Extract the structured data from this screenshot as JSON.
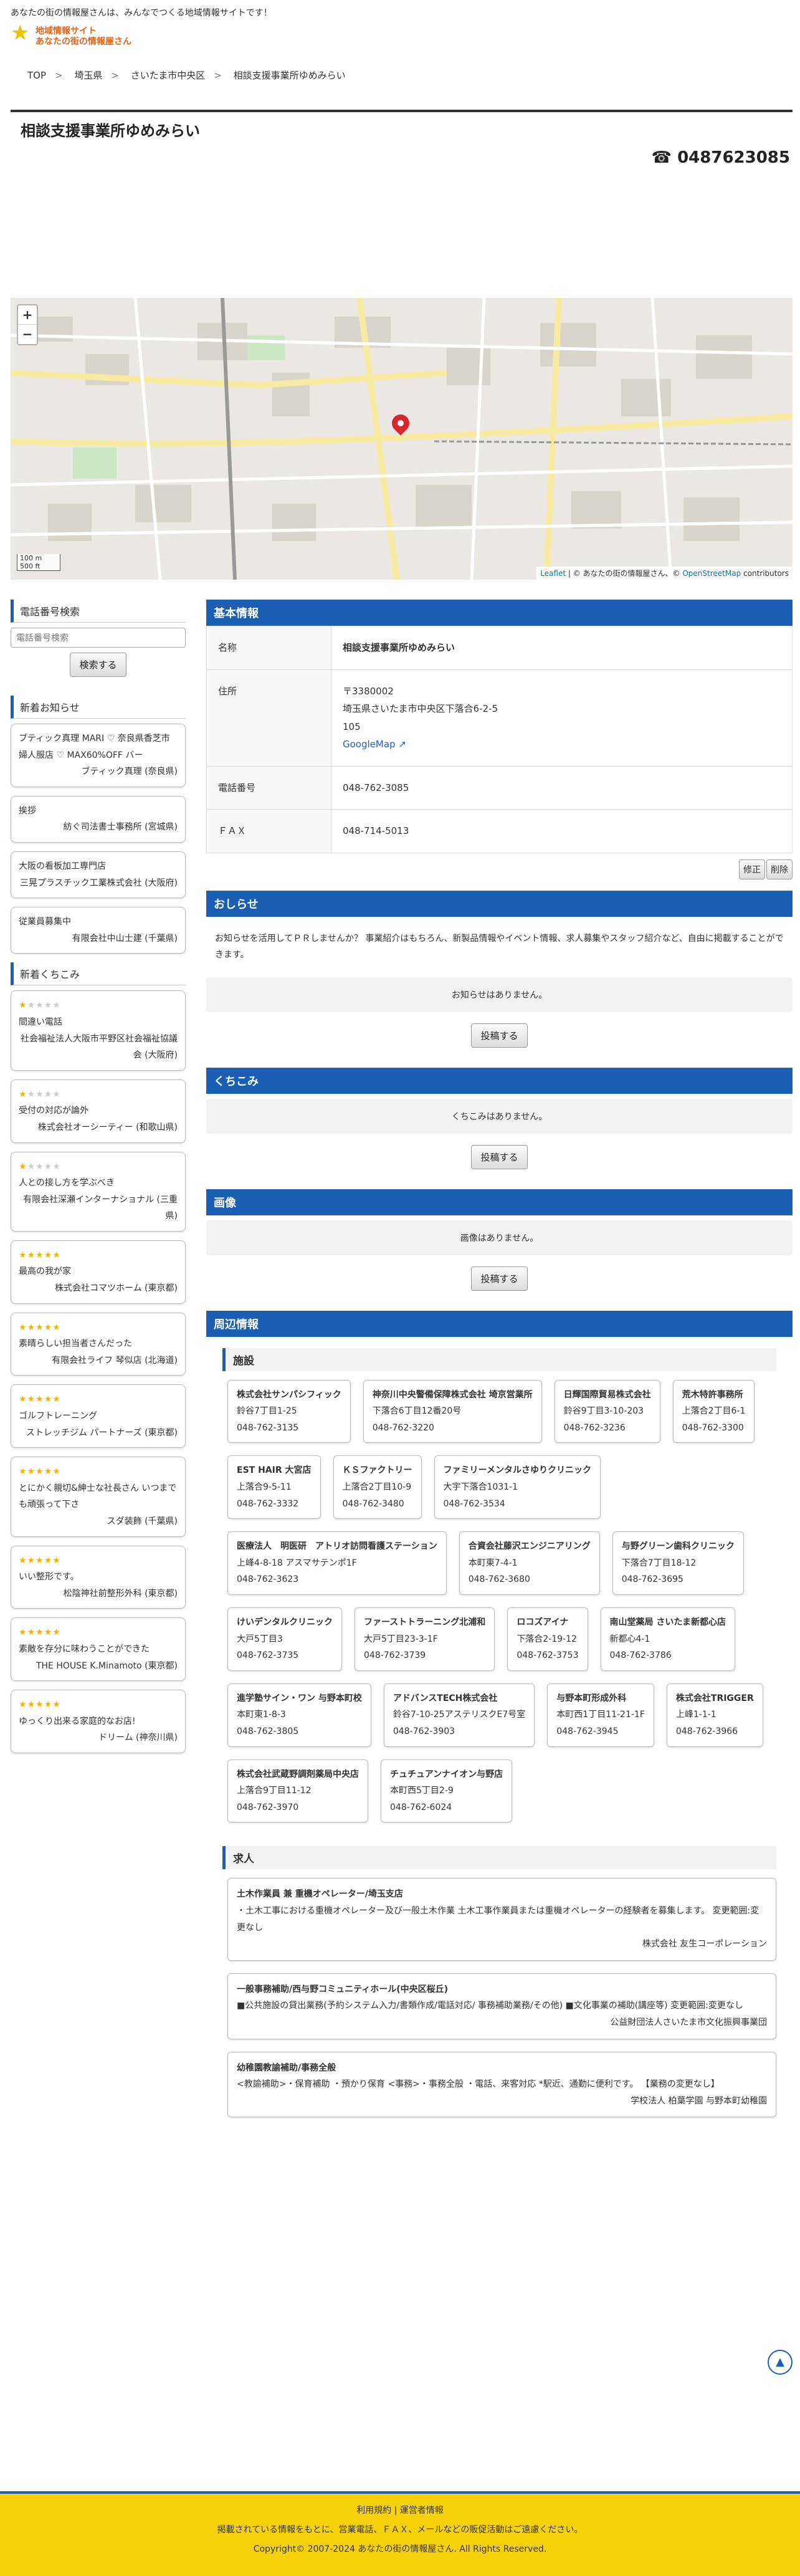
{
  "header": {
    "tagline": "あなたの街の情報屋さんは、みんなでつくる地域情報サイトです！",
    "logo_l1": "地域情報サイト",
    "logo_l2": "あなたの街の情報屋さん"
  },
  "breadcrumb": [
    "TOP",
    "埼玉県",
    "さいたま市中央区",
    "相談支援事業所ゆめみらい"
  ],
  "page": {
    "title": "相談支援事業所ゆめみらい",
    "phone": "☎ 0487623085"
  },
  "map": {
    "zoom_in": "+",
    "zoom_out": "−",
    "scale": "100 m",
    "scale2": "500 ft",
    "attrib_leaflet": "Leaflet",
    "attrib_text": " | © あなたの街の情報屋さん、© ",
    "attrib_osm": "OpenStreetMap",
    "attrib_tail": " contributors"
  },
  "sidebar": {
    "tel_search_title": "電話番号検索",
    "tel_placeholder": "電話番号検索",
    "search_button": "検索する",
    "news_title": "新着お知らせ",
    "news": [
      {
        "text": "ブティック真理 MARI ♡ 奈良県香芝市婦人服店 ♡ MAX60%OFF バー",
        "who": "ブティック真理 (奈良県)"
      },
      {
        "text": "挨拶",
        "who": "紡ぐ司法書士事務所 (宮城県)"
      },
      {
        "text": "大阪の看板加工専門店",
        "who": "三晃プラスチック工業株式会社 (大阪府)"
      },
      {
        "text": "従業員募集中",
        "who": "有限会社中山士建 (千葉県)"
      }
    ],
    "review_title": "新着くちこみ",
    "reviews": [
      {
        "stars": 1,
        "text": "間違い電話",
        "who": "社会福祉法人大阪市平野区社会福祉協議会 (大阪府)"
      },
      {
        "stars": 1,
        "text": "受付の対応が論外",
        "who": "株式会社オーシーティー (和歌山県)"
      },
      {
        "stars": 1,
        "text": "人との接し方を学ぶべき",
        "who": "有限会社深瀬インターナショナル (三重県)"
      },
      {
        "stars": 5,
        "text": "最高の我が家",
        "who": "株式会社コマツホーム (東京都)"
      },
      {
        "stars": 5,
        "text": "素晴らしい担当者さんだった",
        "who": "有限会社ライフ 琴似店 (北海道)"
      },
      {
        "stars": 5,
        "text": "ゴルフトレーニング",
        "who": "ストレッチジム パートナーズ (東京都)"
      },
      {
        "stars": 5,
        "text": "とにかく親切&紳士な社長さん いつまでも頑張って下さ",
        "who": "スダ装飾 (千葉県)"
      },
      {
        "stars": 5,
        "text": "いい整形です。",
        "who": "松陰神社前整形外科 (東京都)"
      },
      {
        "stars": 5,
        "text": "素敵を存分に味わうことができた",
        "who": "THE HOUSE K.Minamoto (東京都)"
      },
      {
        "stars": 5,
        "text": "ゆっくり出来る家庭的なお店!",
        "who": "ドリーム (神奈川県)"
      }
    ]
  },
  "basic": {
    "title": "基本情報",
    "rows": [
      {
        "k": "名称",
        "v": "相談支援事業所ゆめみらい"
      },
      {
        "k": "住所",
        "v": "〒3380002"
      },
      {
        "k": "電話番号",
        "v": "048-762-3085"
      },
      {
        "k": "ＦＡＸ",
        "v": "048-714-5013"
      }
    ],
    "addr2": "埼玉県さいたま市中央区下落合6-2-5",
    "addr3": "105",
    "gmap": "GoogleMap",
    "edit": "修正",
    "del": "削除"
  },
  "notice": {
    "title": "おしらせ",
    "text": "お知らせを活用してＰＲしませんか？ 事業紹介はもちろん、新製品情報やイベント情報、求人募集やスタッフ紹介など、自由に掲載することができます。",
    "empty": "お知らせはありません。",
    "post": "投稿する"
  },
  "kuchikomi": {
    "title": "くちこみ",
    "empty": "くちこみはありません。",
    "post": "投稿する"
  },
  "images": {
    "title": "画像",
    "empty": "画像はありません。",
    "post": "投稿する"
  },
  "nearby": {
    "title": "周辺情報",
    "facilities_title": "施設",
    "places": [
      {
        "n": "株式会社サンパシフィック",
        "a": "鈴谷7丁目1-25",
        "t": "048-762-3135"
      },
      {
        "n": "神奈川中央警備保障株式会社 埼京営業所",
        "a": "下落合6丁目12番20号",
        "t": "048-762-3220"
      },
      {
        "n": "日輝国際貿易株式会社",
        "a": "鈴谷9丁目3-10-203",
        "t": "048-762-3236"
      },
      {
        "n": "荒木特許事務所",
        "a": "上落合2丁目6-1",
        "t": "048-762-3300"
      },
      {
        "n": "EST HAIR 大宮店",
        "a": "上落合9-5-11",
        "t": "048-762-3332"
      },
      {
        "n": "ＫＳファクトリー",
        "a": "上落合2丁目10-9",
        "t": "048-762-3480"
      },
      {
        "n": "ファミリーメンタルさゆりクリニック",
        "a": "大宇下落合1031-1",
        "t": "048-762-3534"
      },
      {
        "n": "医療法人　明医研　アトリオ訪問看護ステーション",
        "a": "上峰4-8-18 アスマサテンポ1F",
        "t": "048-762-3623"
      },
      {
        "n": "合資会社藤沢エンジニアリング",
        "a": "本町東7-4-1",
        "t": "048-762-3680"
      },
      {
        "n": "与野グリーン歯科クリニック",
        "a": "下落合7丁目18-12",
        "t": "048-762-3695"
      },
      {
        "n": "けいデンタルクリニック",
        "a": "大戸5丁目3",
        "t": "048-762-3735"
      },
      {
        "n": "ファーストトラーニング北浦和",
        "a": "大戸5丁目23-3-1F",
        "t": "048-762-3739"
      },
      {
        "n": "ロコズアイナ",
        "a": "下落合2-19-12",
        "t": "048-762-3753"
      },
      {
        "n": "南山堂薬局 さいたま新都心店",
        "a": "新都心4-1",
        "t": "048-762-3786"
      },
      {
        "n": "進学塾サイン・ワン 与野本町校",
        "a": "本町東1-8-3",
        "t": "048-762-3805"
      },
      {
        "n": "アドバンスTECH株式会社",
        "a": "鈴谷7-10-25アステリスクE7号室",
        "t": "048-762-3903"
      },
      {
        "n": "与野本町形成外科",
        "a": "本町西1丁目11-21-1F",
        "t": "048-762-3945"
      },
      {
        "n": "株式会社TRIGGER",
        "a": "上峰1-1-1",
        "t": "048-762-3966"
      },
      {
        "n": "株式会社武蔵野調剤薬局中央店",
        "a": "上落合9丁目11-12",
        "t": "048-762-3970"
      },
      {
        "n": "チュチュアンナイオン与野店",
        "a": "本町西5丁目2-9",
        "t": "048-762-6024"
      }
    ],
    "jobs_title": "求人",
    "jobs": [
      {
        "t": "土木作業員 兼 重機オペレーター/埼玉支店",
        "d": "・土木工事における重機オペレーター及び一般土木作業 土木工事作業員または重機オペレーターの経験者を募集します。 変更範囲:変更なし",
        "by": "株式会社 友生コーポレーション"
      },
      {
        "t": "一般事務補助/西与野コミュニティホール(中央区桜丘)",
        "d": "■公共施設の貸出業務(予約システム入力/書類作成/電話対応/ 事務補助業務/その他) ■文化事業の補助(講座等) 変更範囲:変更なし",
        "by": "公益財団法人さいたま市文化振興事業団"
      },
      {
        "t": "幼稚園教諭補助/事務全般",
        "d": "<教諭補助>・保育補助 ・預かり保育 <事務>・事務全般 ・電話、来客対応 *駅近、通勤に便利です。 【業務の変更なし】",
        "by": "学校法人 柏葉学園 与野本町幼稚園"
      }
    ]
  },
  "footer": {
    "links": "利用規約 | 運営者情報",
    "notice": "掲載されている情報をもとに、営業電話、ＦＡＸ、メールなどの販促活動はご遠慮ください。",
    "copy": "Copyright© 2007-2024 あなたの街の情報屋さん.  All Rights Reserved."
  },
  "totop": "▲"
}
